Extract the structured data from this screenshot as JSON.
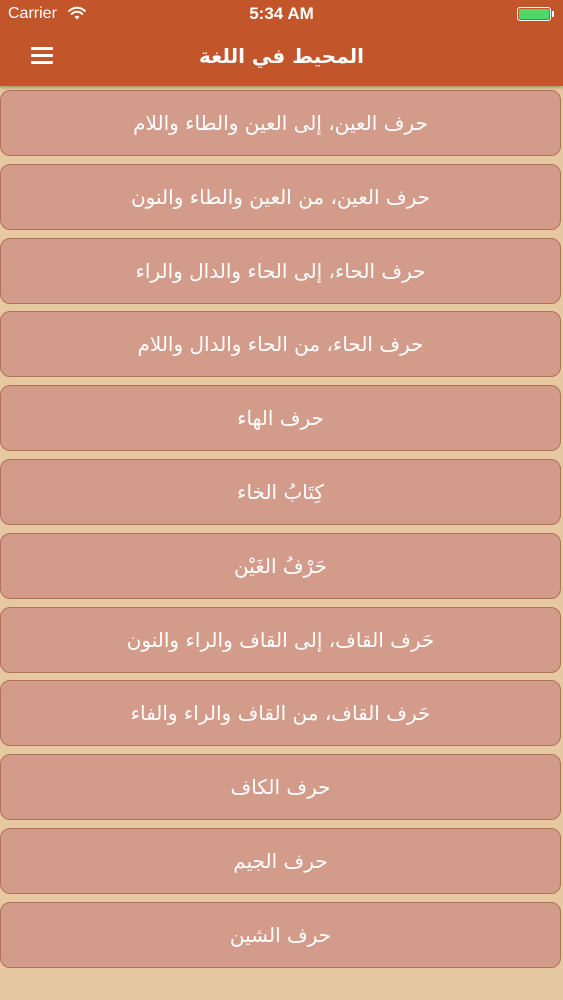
{
  "status_bar": {
    "carrier": "Carrier",
    "time": "5:34 AM"
  },
  "colors": {
    "nav_bar": "#c2562a",
    "list_item": "#d39b8a",
    "list_item_border": "#b5705a",
    "battery": "#4cd964"
  },
  "nav": {
    "title": "المحيط في اللغة",
    "menu_icon": "hamburger-menu-icon"
  },
  "items": [
    "حرف العين، إلى العين والطاء واللام",
    "حرف العين، من العين والطاء والنون",
    "حرف الحاء، إلى الحاء والدال والراء",
    "حرف الحاء، من الحاء والدال واللام",
    "حرف الهاء",
    "كِتَابُ الخاء",
    "حَرْفُ الغَيْن",
    "حَرف القاف، إلى القاف والراء والنون",
    "حَرف القاف، من القاف والراء والفاء",
    "حرف الكاف",
    "حرف الجيم",
    "حرف الشين"
  ]
}
